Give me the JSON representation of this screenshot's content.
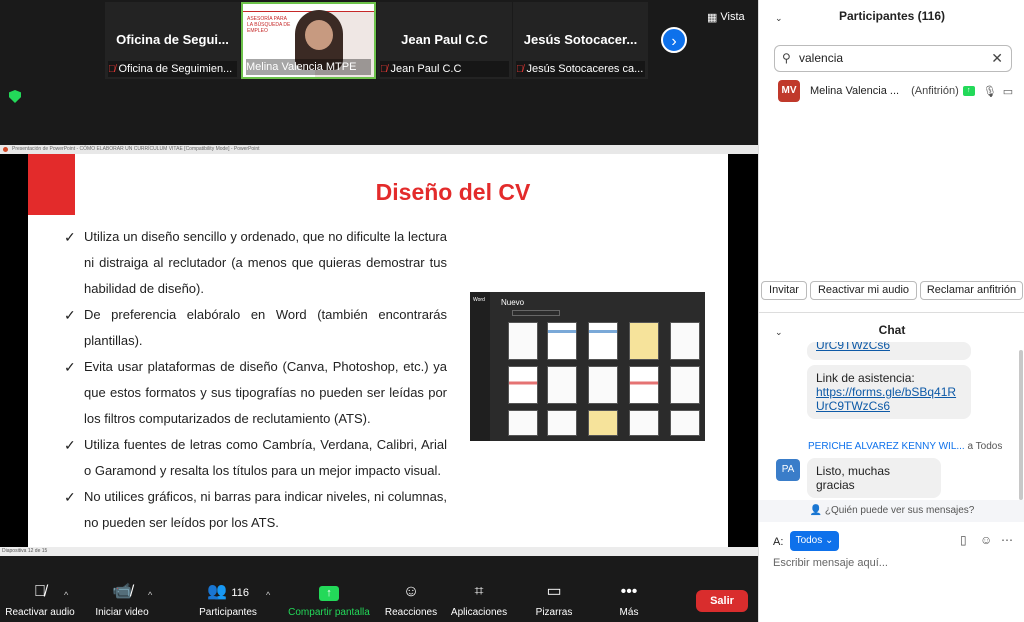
{
  "top_strip": {
    "tiles": [
      {
        "name": "Oficina  de  Segui...",
        "footer": "Oficina de Seguimien..."
      },
      {
        "name": "",
        "footer": "Melina Valencia MTPE"
      },
      {
        "name": "Jean Paul C.C",
        "footer": "Jean Paul C.C"
      },
      {
        "name": "Jesús  Sotocacer...",
        "footer": "Jesús Sotocaceres ca..."
      }
    ],
    "active_speaker_slide_text": "ASESORÍA PARA LA BÚSQUEDA DE EMPLEO",
    "view_label": "Vista"
  },
  "ppt": {
    "window_title": "Presentación de PowerPoint - CÓMO ELABORAR UN CURRÍCULUM VITAE [Compatibility Mode] - PowerPoint",
    "status": "Diapositiva 12 de 15",
    "slide_title": "Diseño del CV",
    "bullets": [
      "Utiliza un diseño sencillo y ordenado,  que no dificulte la lectura ni distraiga al reclutador (a menos que quieras demostrar tus habilidad de diseño).",
      "De preferencia elabóralo en Word (también encontrarás plantillas).",
      "Evita usar plataformas de diseño (Canva, Photoshop, etc.) ya que estos formatos y sus tipografías no pueden ser leídas por los filtros computarizados de reclutamiento (ATS).",
      "Utiliza fuentes de letras como Cambría, Verdana, Calibri, Arial o Garamond y resalta los títulos para un mejor impacto visual.",
      "No utilices gráficos, ni barras para indicar niveles, ni columnas, no pueden ser leídos por los ATS."
    ],
    "word_screenshot": {
      "app": "Word",
      "heading": "Nuevo"
    }
  },
  "toolbar": {
    "audio": "Reactivar audio",
    "video": "Iniciar video",
    "participants": "Participantes",
    "participants_count": "116",
    "share": "Compartir pantalla",
    "reactions": "Reacciones",
    "apps": "Aplicaciones",
    "whiteboards": "Pizarras",
    "more": "Más",
    "leave": "Salir"
  },
  "participants_panel": {
    "title": "Participantes (116)",
    "search_value": "valencia",
    "rows": [
      {
        "initials": "MV",
        "name": "Melina Valencia ...",
        "role": "(Anfitrión)"
      }
    ],
    "buttons": [
      "Invitar",
      "Reactivar mi audio",
      "Reclamar anfitrión"
    ]
  },
  "chat_panel": {
    "title": "Chat",
    "truncated_top": "UrC9TWzCs6",
    "message1_label": "Link de asistencia:",
    "message1_link": "https://forms.gle/bSBq41RUrC9TWzCs6",
    "sender_name": "PERICHE ALVAREZ KENNY WIL...",
    "sender_to": "a Todos",
    "sender_initials": "PA",
    "message2": "Listo, muchas gracias",
    "who_can_see": "¿Quién puede ver sus mensajes?",
    "to_label": "A:",
    "to_value": "Todos",
    "input_placeholder": "Escribir mensaje aquí..."
  },
  "colors": {
    "accent": "#0e71eb",
    "share_green": "#23d959",
    "leave_red": "#d92d2d",
    "slide_red": "#e32b2b"
  }
}
